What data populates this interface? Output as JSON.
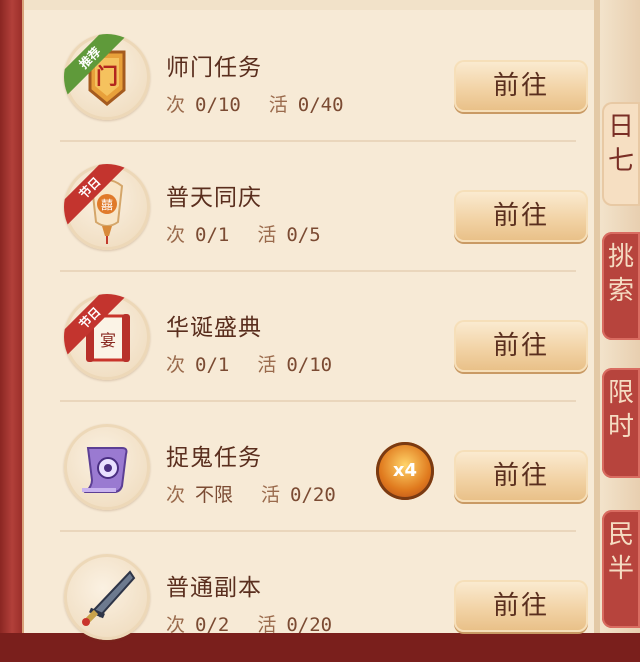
{
  "tasks": [
    {
      "title": "师门任务",
      "count_key": "次",
      "count_val": "0/10",
      "act_key": "活",
      "act_val": "0/40",
      "button": "前往",
      "tag": "推荐",
      "tag_color": "#5f9a3a",
      "icon": "sect-banner-icon"
    },
    {
      "title": "普天同庆",
      "count_key": "次",
      "count_val": "0/1",
      "act_key": "活",
      "act_val": "0/5",
      "button": "前往",
      "tag": "节日",
      "tag_color": "#c3342e",
      "icon": "lantern-icon"
    },
    {
      "title": "华诞盛典",
      "count_key": "次",
      "count_val": "0/1",
      "act_key": "活",
      "act_val": "0/10",
      "button": "前往",
      "tag": "节日",
      "tag_color": "#c3342e",
      "icon": "banquet-scroll-icon"
    },
    {
      "title": "捉鬼任务",
      "count_key": "次",
      "count_val": "不限",
      "act_key": "活",
      "act_val": "0/20",
      "button": "前往",
      "tag": "",
      "tag_color": "",
      "icon": "ghost-scroll-icon",
      "bonus": "x4"
    },
    {
      "title": "普通副本",
      "count_key": "次",
      "count_val": "0/2",
      "act_key": "活",
      "act_val": "0/20",
      "button": "前往",
      "tag": "",
      "tag_color": "",
      "icon": "sword-icon"
    }
  ],
  "side_tabs": [
    {
      "label": "日\n七",
      "active": true
    },
    {
      "label": "挑\n索",
      "active": false
    },
    {
      "label": "限\n时",
      "active": false
    },
    {
      "label": "民\n半",
      "active": false
    }
  ]
}
